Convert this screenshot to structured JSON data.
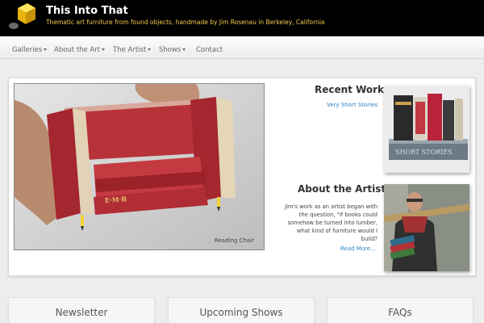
{
  "header": {
    "title": "This Into That",
    "tagline": "Thematic art furniture from found objects, handmade by Jim Rosenau in Berkeley, California",
    "logo_icon": "gold-cube-logo"
  },
  "nav": {
    "items": [
      {
        "label": "Galleries",
        "dropdown": true
      },
      {
        "label": "About the Art",
        "dropdown": true
      },
      {
        "label": "The Artist",
        "dropdown": true
      },
      {
        "label": "Shows",
        "dropdown": true
      },
      {
        "label": "Contact",
        "dropdown": false
      }
    ]
  },
  "hero": {
    "caption": "Reading Chair"
  },
  "recent_work": {
    "title": "Recent Work",
    "link": "Very Short Stories"
  },
  "about_artist": {
    "title": "About the Artist",
    "text": "Jim's work as an artist began with the question, \"if books could somehow be turned into lumber, what kind of furniture would I build?",
    "link": "Read More..."
  },
  "cards": [
    {
      "title": "Newsletter"
    },
    {
      "title": "Upcoming Shows"
    },
    {
      "title": "FAQs"
    }
  ],
  "colors": {
    "header_bg": "#000000",
    "tagline": "#f2c94c",
    "link": "#2a86c6",
    "page_bg": "#ededed"
  }
}
